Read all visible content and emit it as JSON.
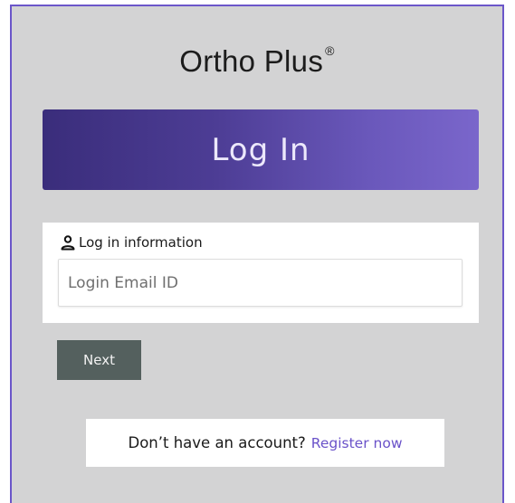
{
  "brand": {
    "name": "Ortho Plus",
    "mark": "®"
  },
  "banner": {
    "title": "Log In"
  },
  "login_info": {
    "label": "Log in information",
    "icon": "person-icon",
    "email_placeholder": "Login Email ID",
    "email_value": ""
  },
  "actions": {
    "next_label": "Next"
  },
  "register": {
    "prompt": "Don’t have an account?",
    "link_label": "Register now"
  },
  "colors": {
    "accent": "#6a52c9",
    "banner_start": "#3a2d7b",
    "banner_end": "#7a66cb",
    "button": "#54605e",
    "background": "#d3d3d4"
  }
}
